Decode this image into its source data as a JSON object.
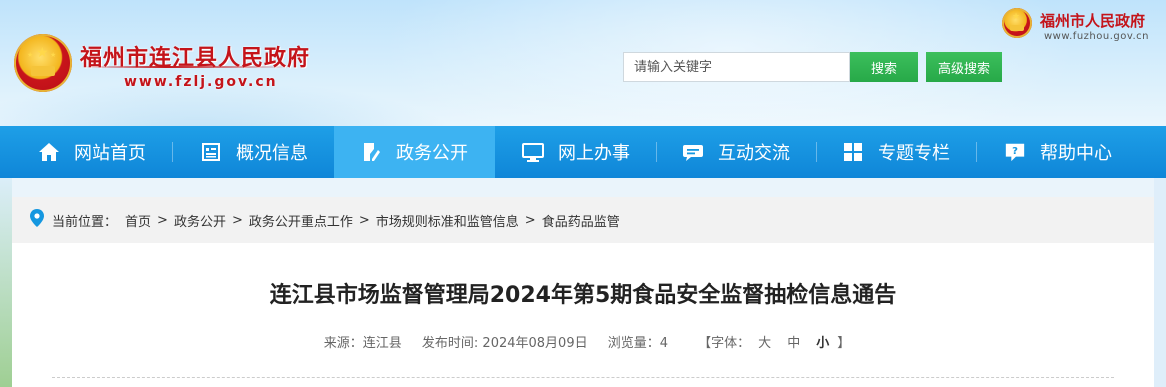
{
  "header": {
    "site_title": "福州市连江县人民政府",
    "site_url": "www.fzlj.gov.cn",
    "city_title": "福州市人民政府",
    "city_url": "www.fuzhou.gov.cn",
    "search": {
      "placeholder": "请输入关键字",
      "value": "",
      "search_label": "搜索",
      "advanced_label": "高级搜索"
    }
  },
  "nav": {
    "items": [
      {
        "label": "网站首页",
        "icon": "home-icon",
        "active": false
      },
      {
        "label": "概况信息",
        "icon": "document-icon",
        "active": false
      },
      {
        "label": "政务公开",
        "icon": "file-edit-icon",
        "active": true
      },
      {
        "label": "网上办事",
        "icon": "monitor-icon",
        "active": false
      },
      {
        "label": "互动交流",
        "icon": "chat-icon",
        "active": false
      },
      {
        "label": "专题专栏",
        "icon": "grid-icon",
        "active": false
      },
      {
        "label": "帮助中心",
        "icon": "help-icon",
        "active": false
      }
    ]
  },
  "breadcrumb": {
    "label": "当前位置：",
    "items": [
      "首页",
      "政务公开",
      "政务公开重点工作",
      "市场规则标准和监管信息",
      "食品药品监管"
    ],
    "separator": ">"
  },
  "article": {
    "title": "连江县市场监督管理局2024年第5期食品安全监督抽检信息通告",
    "source": "来源：连江县",
    "publish_time": "发布时间: 2024年08月09日",
    "views": "浏览量：4",
    "font_size_label": "【字体：",
    "size_large": "大",
    "size_medium": "中",
    "size_small": "小",
    "font_size_close": "】"
  },
  "colors": {
    "brand_red": "#c4141a",
    "nav_blue": "#1497e0",
    "nav_active": "#3db3f2",
    "button_green": "#2fb350"
  }
}
